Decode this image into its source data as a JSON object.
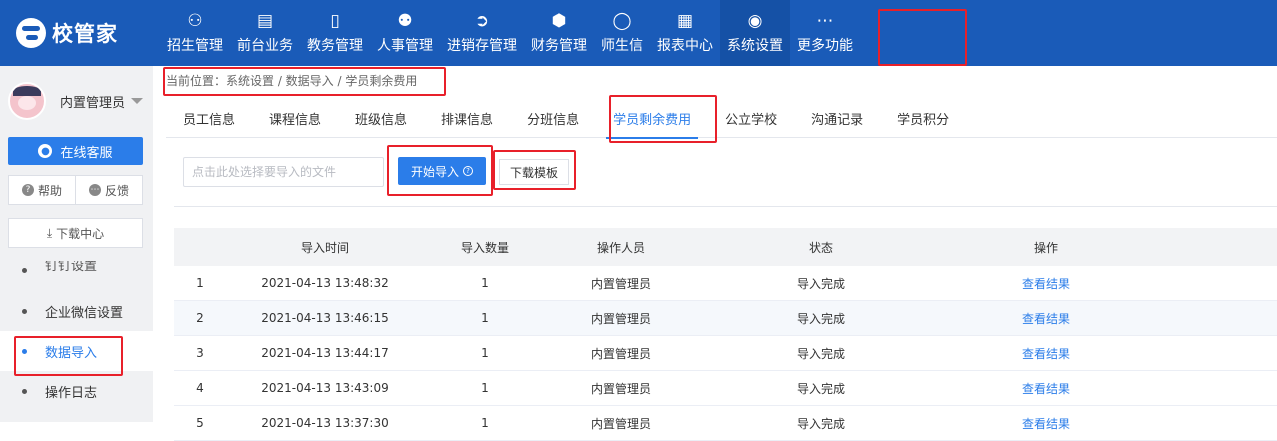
{
  "app": {
    "logo_text": "校管家"
  },
  "nav": {
    "items": [
      {
        "label": "招生管理",
        "icon": "recruit-icon"
      },
      {
        "label": "前台业务",
        "icon": "front-desk-icon"
      },
      {
        "label": "教务管理",
        "icon": "academic-icon"
      },
      {
        "label": "人事管理",
        "icon": "person-icon"
      },
      {
        "label": "进销存管理",
        "icon": "inventory-icon"
      },
      {
        "label": "财务管理",
        "icon": "finance-icon"
      },
      {
        "label": "师生信",
        "icon": "chat-icon"
      },
      {
        "label": "报表中心",
        "icon": "report-icon"
      },
      {
        "label": "系统设置",
        "icon": "settings-icon"
      },
      {
        "label": "更多功能",
        "icon": "more-icon"
      }
    ],
    "active_index": 8
  },
  "sidebar": {
    "user_name": "内置管理员",
    "service_label": "在线客服",
    "help_label": "帮助",
    "feedback_label": "反馈",
    "download_label": "下载中心",
    "menu": [
      {
        "label": "钉钉设置"
      },
      {
        "label": "企业微信设置"
      },
      {
        "label": "数据导入"
      },
      {
        "label": "操作日志"
      }
    ]
  },
  "breadcrumb": {
    "text": "当前位置：系统设置 / 数据导入 / 学员剩余费用"
  },
  "tabs": [
    {
      "label": "员工信息"
    },
    {
      "label": "课程信息"
    },
    {
      "label": "班级信息"
    },
    {
      "label": "排课信息"
    },
    {
      "label": "分班信息"
    },
    {
      "label": "学员剩余费用"
    },
    {
      "label": "公立学校"
    },
    {
      "label": "沟通记录"
    },
    {
      "label": "学员积分"
    }
  ],
  "toolbar": {
    "file_placeholder": "点击此处选择要导入的文件",
    "import_label": "开始导入",
    "template_label": "下载模板"
  },
  "table": {
    "headers": [
      "",
      "导入时间",
      "导入数量",
      "操作人员",
      "状态",
      "操作"
    ],
    "rows": [
      {
        "idx": "1",
        "time": "2021-04-13 13:48:32",
        "count": "1",
        "operator": "内置管理员",
        "status": "导入完成",
        "action": "查看结果"
      },
      {
        "idx": "2",
        "time": "2021-04-13 13:46:15",
        "count": "1",
        "operator": "内置管理员",
        "status": "导入完成",
        "action": "查看结果"
      },
      {
        "idx": "3",
        "time": "2021-04-13 13:44:17",
        "count": "1",
        "operator": "内置管理员",
        "status": "导入完成",
        "action": "查看结果"
      },
      {
        "idx": "4",
        "time": "2021-04-13 13:43:09",
        "count": "1",
        "operator": "内置管理员",
        "status": "导入完成",
        "action": "查看结果"
      },
      {
        "idx": "5",
        "time": "2021-04-13 13:37:30",
        "count": "1",
        "operator": "内置管理员",
        "status": "导入完成",
        "action": "查看结果"
      }
    ]
  },
  "colors": {
    "header_bg": "#1a5bb8",
    "accent": "#2b7de9",
    "highlight": "#e8202a"
  }
}
